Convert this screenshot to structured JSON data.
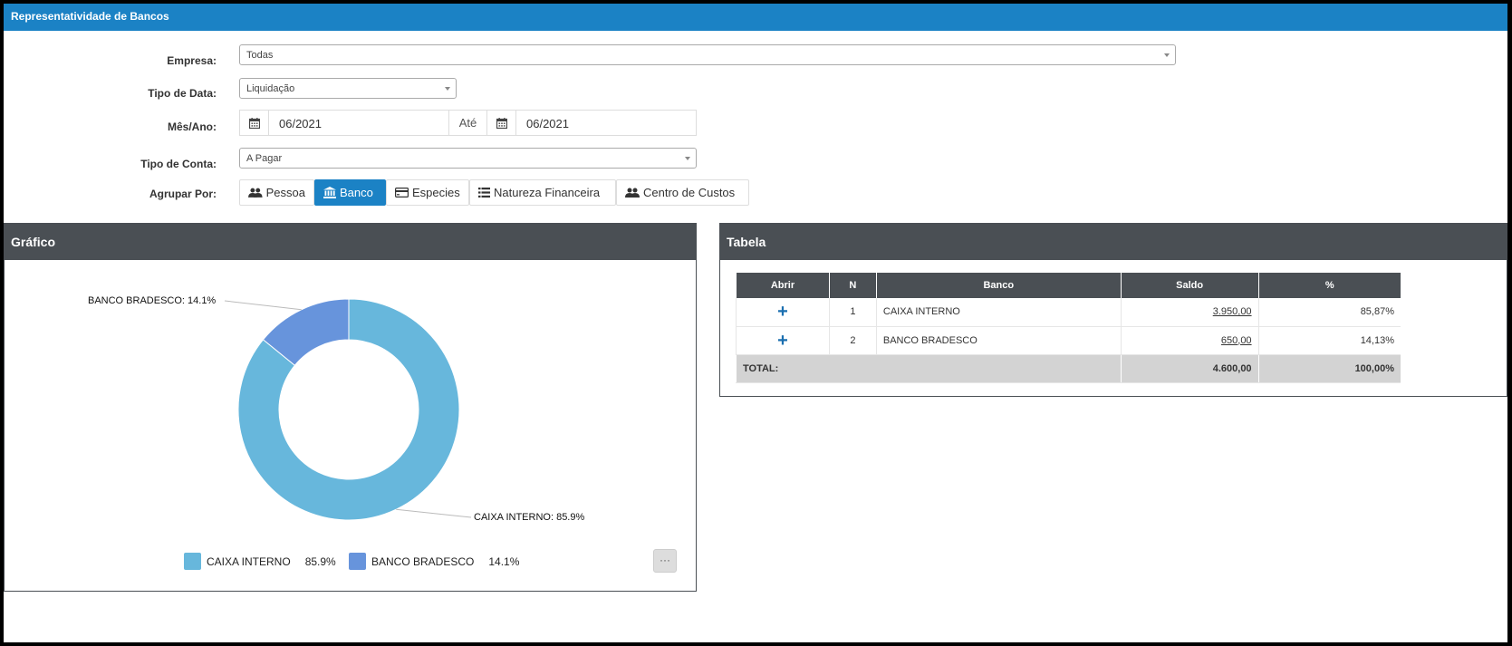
{
  "window": {
    "title": "Representatividade de Bancos"
  },
  "form": {
    "empresa": {
      "label": "Empresa:",
      "value": "Todas"
    },
    "tipo_data": {
      "label": "Tipo de Data:",
      "value": "Liquidação"
    },
    "mes_ano": {
      "label": "Mês/Ano:",
      "from": "06/2021",
      "separator": "Até",
      "to": "06/2021"
    },
    "tipo_conta": {
      "label": "Tipo de Conta:",
      "value": "A Pagar"
    },
    "agrupar": {
      "label": "Agrupar Por:",
      "options": [
        "Pessoa",
        "Banco",
        "Especies",
        "Natureza Financeira",
        "Centro de Custos"
      ],
      "selected": "Banco"
    }
  },
  "grafico": {
    "title": "Gráfico",
    "menu_label": "···",
    "chart_data": {
      "type": "pie",
      "categories": [
        "CAIXA INTERNO",
        "BANCO BRADESCO"
      ],
      "values": [
        85.9,
        14.1
      ],
      "colors": [
        "#67b7dc",
        "#6794dc"
      ],
      "labels": [
        "CAIXA INTERNO: 85.9%",
        "BANCO BRADESCO: 14.1%"
      ],
      "legend": [
        {
          "name": "CAIXA INTERNO",
          "value": "85.9%"
        },
        {
          "name": "BANCO BRADESCO",
          "value": "14.1%"
        }
      ],
      "legend_position": "bottom"
    }
  },
  "tabela": {
    "title": "Tabela",
    "headers": [
      "Abrir",
      "N",
      "Banco",
      "Saldo",
      "%"
    ],
    "rows": [
      {
        "n": "1",
        "banco": "CAIXA INTERNO",
        "saldo": "3.950,00",
        "pct": "85,87%"
      },
      {
        "n": "2",
        "banco": "BANCO BRADESCO",
        "saldo": "650,00",
        "pct": "14,13%"
      }
    ],
    "total": {
      "label": "TOTAL:",
      "saldo": "4.600,00",
      "pct": "100,00%"
    }
  }
}
